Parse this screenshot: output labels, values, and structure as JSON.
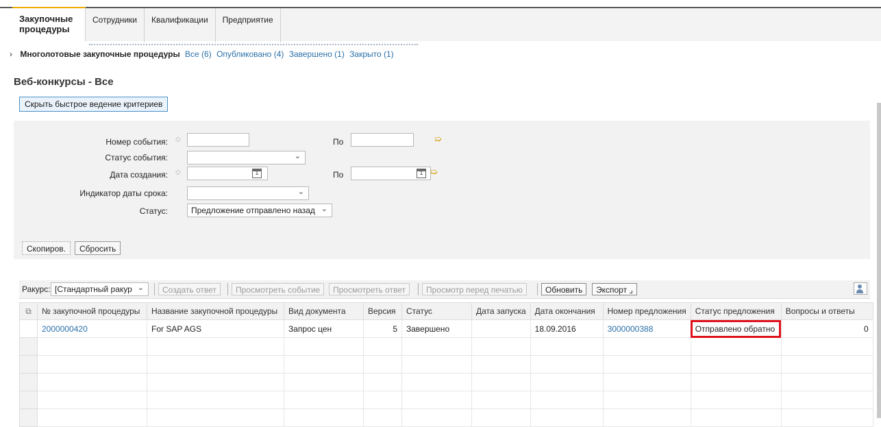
{
  "tabs": [
    {
      "label": "Закупочные процедуры",
      "active": true
    },
    {
      "label": "Сотрудники"
    },
    {
      "label": "Квалификации"
    },
    {
      "label": "Предприятие"
    }
  ],
  "subnav": {
    "current": "Многолотовые закупочные процедуры",
    "links": [
      "Все (6)",
      "Опубликовано (4)",
      "Завершено (1)",
      "Закрыто (1)"
    ]
  },
  "page": {
    "title": "Веб-конкурсы - Все",
    "toggle_button": "Скрыть быстрое ведение критериев"
  },
  "criteria": {
    "event_number_label": "Номер события:",
    "to_label": "По",
    "event_status_label": "Статус события:",
    "created_date_label": "Дата создания:",
    "deadline_indicator_label": "Индикатор даты срока:",
    "status_label": "Статус:",
    "status_value": "Предложение отправлено назад",
    "copy_button": "Скопиров.",
    "reset_button": "Сбросить"
  },
  "toolbar": {
    "view_label": "Ракурс:",
    "view_value": "[Стандартный ракур",
    "create_response": "Создать ответ",
    "view_event": "Просмотреть событие",
    "view_response": "Просмотреть ответ",
    "print_preview": "Просмотр перед печатью",
    "refresh": "Обновить",
    "export": "Экспорт"
  },
  "table": {
    "columns": [
      "№ закупочной процедуры",
      "Название закупочной процедуры",
      "Вид документа",
      "Версия",
      "Статус",
      "Дата запуска",
      "Дата окончания",
      "Номер предложения",
      "Статус предложения",
      "Вопросы и ответы"
    ],
    "rows": [
      {
        "procedure_no": "2000000420",
        "name": "For SAP AGS",
        "doc_type": "Запрос цен",
        "version": "5",
        "status": "Завершено",
        "start_date": "",
        "end_date": "18.09.2016",
        "offer_no": "3000000388",
        "offer_status": "Отправлено обратно",
        "qa": "0"
      }
    ]
  },
  "colors": {
    "link": "#2a6fa8",
    "highlight_border": "#e0111b",
    "tab_accent": "#f0ab00"
  }
}
